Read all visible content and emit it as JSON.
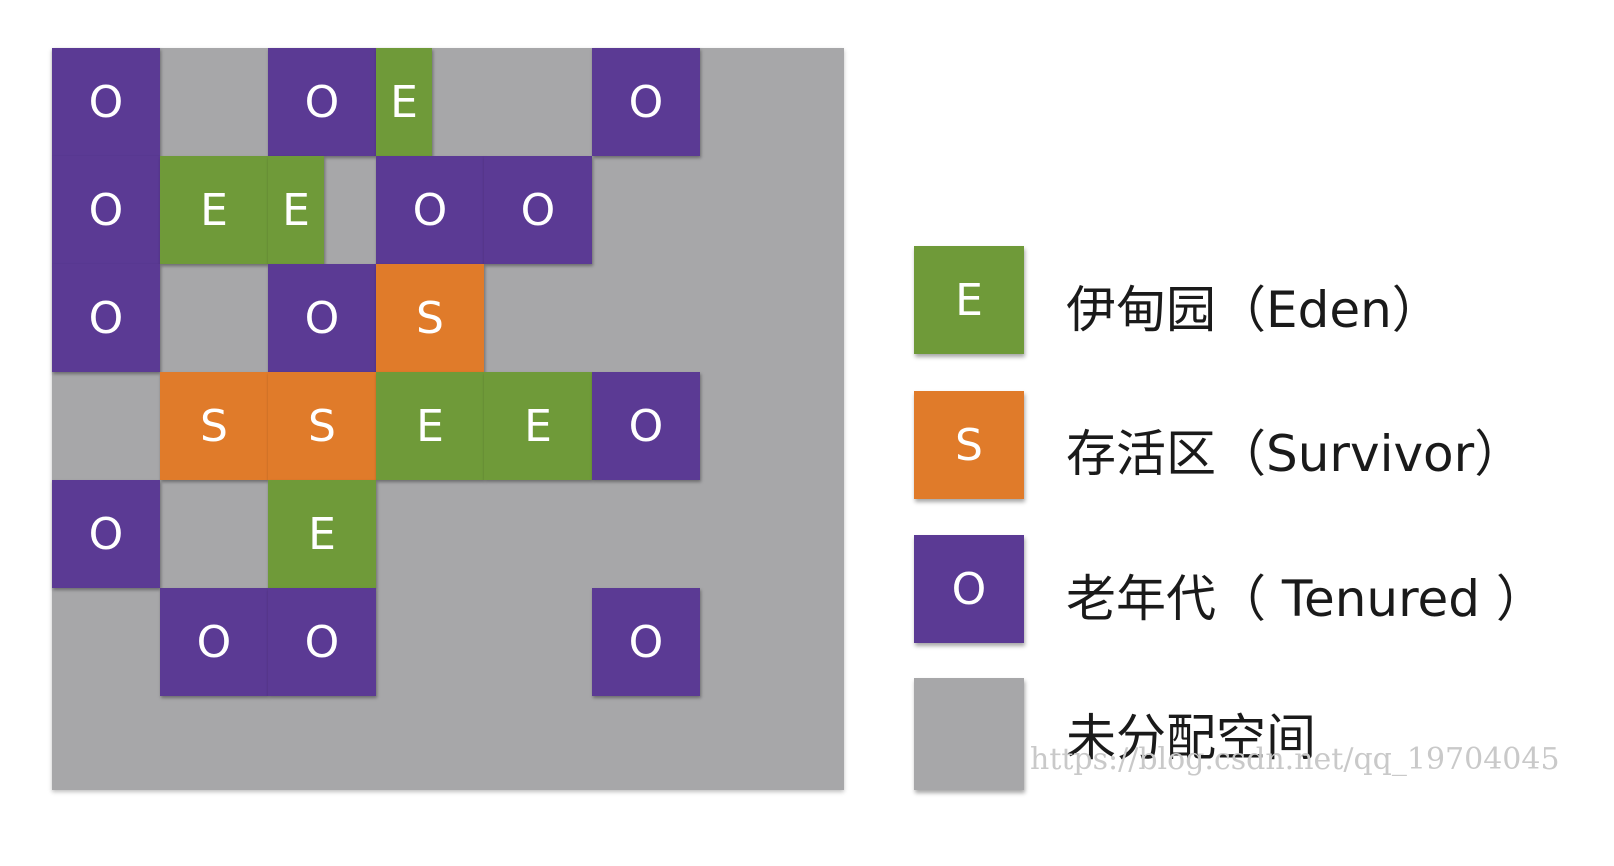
{
  "colors": {
    "eden": "#6f9a39",
    "survivor": "#e07b2a",
    "tenured": "#5b3a94",
    "unallocated": "#a7a7a9"
  },
  "grid": {
    "cells": [
      {
        "row": 0,
        "col": 0,
        "type": "O",
        "label": "O"
      },
      {
        "row": 0,
        "col": 2,
        "type": "O",
        "label": "O"
      },
      {
        "row": 0,
        "col": 3,
        "type": "E",
        "label": "E",
        "narrow": true
      },
      {
        "row": 0,
        "col": 5,
        "type": "O",
        "label": "O"
      },
      {
        "row": 1,
        "col": 0,
        "type": "O",
        "label": "O"
      },
      {
        "row": 1,
        "col": 1,
        "type": "E",
        "label": "E"
      },
      {
        "row": 1,
        "col": 2,
        "type": "E",
        "label": "E",
        "narrow": true
      },
      {
        "row": 1,
        "col": 3,
        "type": "O",
        "label": "O"
      },
      {
        "row": 1,
        "col": 4,
        "type": "O",
        "label": "O"
      },
      {
        "row": 2,
        "col": 0,
        "type": "O",
        "label": "O"
      },
      {
        "row": 2,
        "col": 2,
        "type": "O",
        "label": "O"
      },
      {
        "row": 2,
        "col": 3,
        "type": "S",
        "label": "S"
      },
      {
        "row": 3,
        "col": 1,
        "type": "S",
        "label": "S"
      },
      {
        "row": 3,
        "col": 2,
        "type": "S",
        "label": "S"
      },
      {
        "row": 3,
        "col": 3,
        "type": "E",
        "label": "E"
      },
      {
        "row": 3,
        "col": 4,
        "type": "E",
        "label": "E"
      },
      {
        "row": 3,
        "col": 5,
        "type": "O",
        "label": "O"
      },
      {
        "row": 4,
        "col": 0,
        "type": "O",
        "label": "O"
      },
      {
        "row": 4,
        "col": 2,
        "type": "E",
        "label": "E"
      },
      {
        "row": 5,
        "col": 1,
        "type": "O",
        "label": "O"
      },
      {
        "row": 5,
        "col": 2,
        "type": "O",
        "label": "O"
      },
      {
        "row": 5,
        "col": 5,
        "type": "O",
        "label": "O"
      }
    ]
  },
  "legend": {
    "eden": {
      "swatch": "E",
      "label": "伊甸园（Eden）"
    },
    "survivor": {
      "swatch": "S",
      "label": "存活区（Survivor）"
    },
    "tenured": {
      "swatch": "O",
      "label": "老年代（ Tenured ）"
    },
    "unallocated": {
      "label": "未分配空间"
    }
  },
  "watermark": "https://blog.csdn.net/qq_19704045"
}
